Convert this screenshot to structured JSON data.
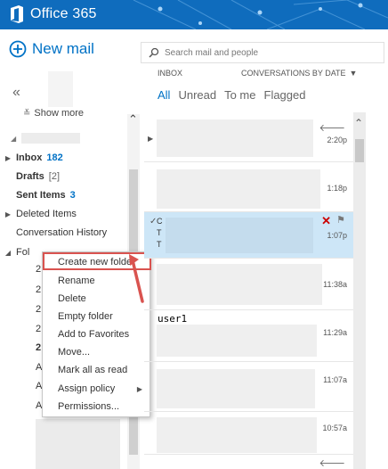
{
  "header": {
    "app_title": "Office 365",
    "colors": {
      "bar": "#0f6cbd",
      "accent": "#0072c6",
      "highlight_border": "#d9534f"
    }
  },
  "left": {
    "new_mail_label": "New mail",
    "show_more_label": "Show more",
    "folders": [
      {
        "name": "Inbox",
        "count": "182"
      },
      {
        "name": "Drafts",
        "count": "[2]"
      },
      {
        "name": "Sent Items",
        "count": "3"
      },
      {
        "name": "Deleted Items"
      },
      {
        "name": "Conversation History"
      },
      {
        "name": "Fol"
      }
    ],
    "subfolder_letters": [
      "2",
      "2",
      "2",
      "2",
      "2",
      "A",
      "A",
      "A"
    ]
  },
  "context_menu": {
    "items": [
      "Create new folder",
      "Rename",
      "Delete",
      "Empty folder",
      "Add to Favorites",
      "Move...",
      "Mark all as read",
      "Assign policy",
      "Permissions..."
    ]
  },
  "search": {
    "placeholder": "Search mail and people"
  },
  "list": {
    "folder_label": "INBOX",
    "sort_label": "CONVERSATIONS BY DATE",
    "filters": [
      "All",
      "Unread",
      "To me",
      "Flagged"
    ],
    "messages": [
      {
        "time": "2:20p"
      },
      {
        "time": "1:18p"
      },
      {
        "time": "1:07p",
        "lines": [
          "C",
          "T",
          "T"
        ]
      },
      {
        "time": "11:38a"
      },
      {
        "time": "11:29a"
      },
      {
        "time": "11:07a"
      },
      {
        "time": "10:57a"
      }
    ],
    "overlay_text": "user1"
  }
}
